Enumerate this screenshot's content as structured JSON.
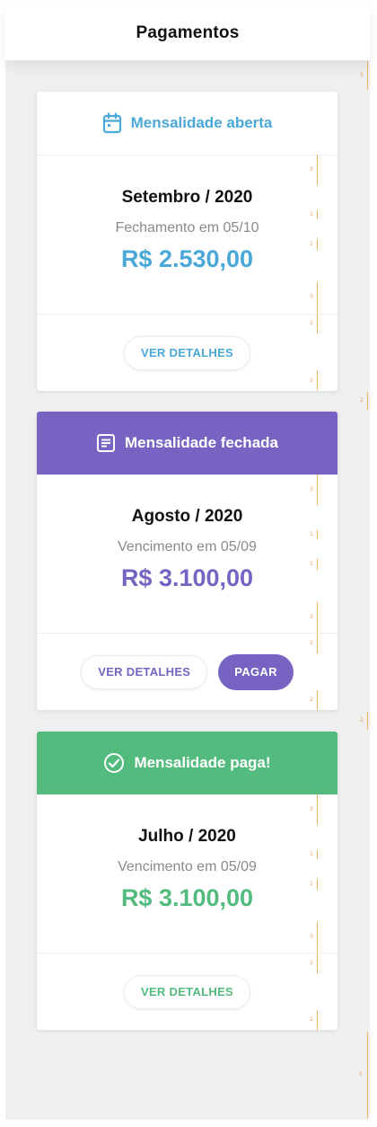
{
  "header": {
    "title": "Pagamentos"
  },
  "cards": [
    {
      "status": "Mensalidade aberta",
      "status_icon": "calendar-icon",
      "period": "Setembro / 2020",
      "due": "Fechamento em 05/10",
      "amount": "R$ 2.530,00",
      "details_label": "VER DETALHES",
      "accent": "#4aa8d8"
    },
    {
      "status": "Mensalidade fechada",
      "status_icon": "document-icon",
      "period": "Agosto / 2020",
      "due": "Vencimento em 05/09",
      "amount": "R$ 3.100,00",
      "details_label": "VER DETALHES",
      "pay_label": "PAGAR",
      "accent": "#7764c2"
    },
    {
      "status": "Mensalidade paga!",
      "status_icon": "check-circle-icon",
      "period": "Julho / 2020",
      "due": "Vencimento em 05/09",
      "amount": "R$ 3.100,00",
      "details_label": "VER DETALHES",
      "accent": "#52bb7d"
    }
  ],
  "guide_marks": [
    "3",
    "3",
    "1",
    "1",
    "3",
    "2",
    "2",
    "2",
    "3",
    "1",
    "1",
    "3",
    "2",
    "2",
    "2",
    "3",
    "1",
    "1",
    "3",
    "2",
    "2",
    "5"
  ]
}
